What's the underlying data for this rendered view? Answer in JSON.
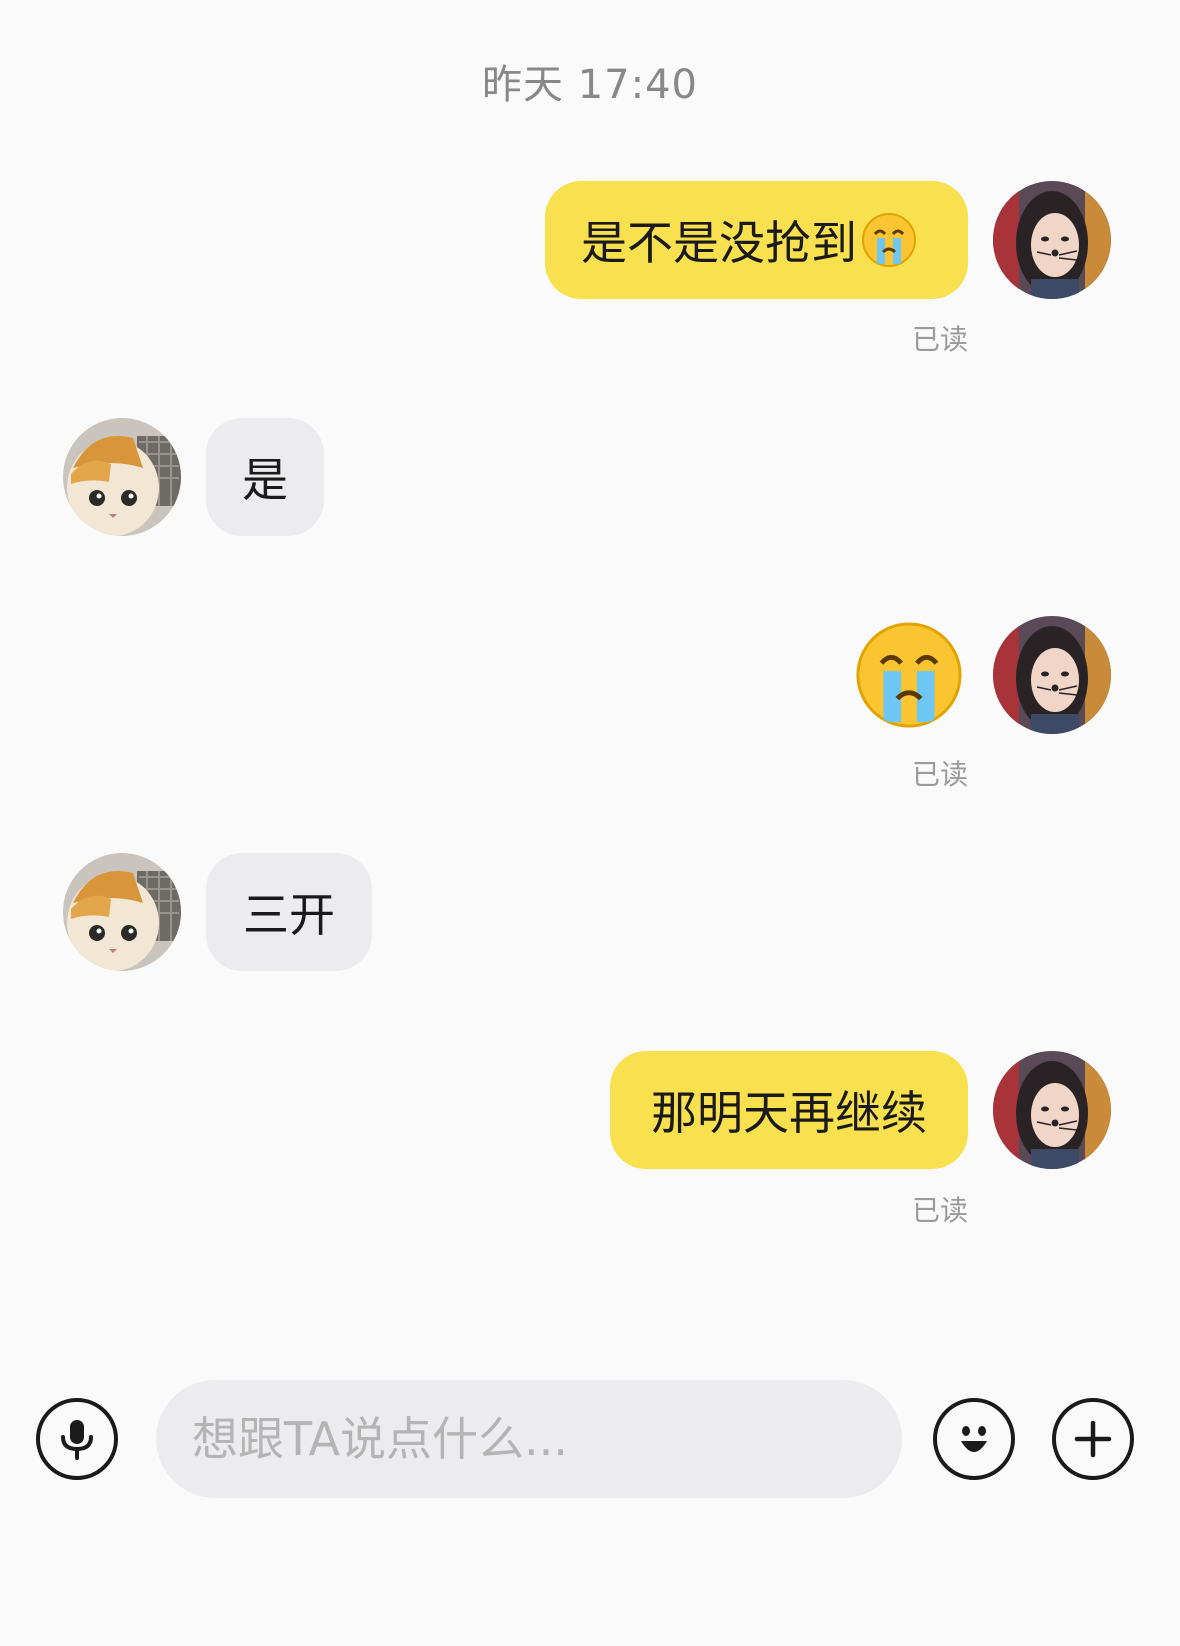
{
  "chat": {
    "timestamp": "昨天 17:40",
    "messages": [
      {
        "side": "mine",
        "text": "是不是没抢到",
        "inline_emoji": "crying-face-emoji",
        "status": "已读"
      },
      {
        "side": "theirs",
        "text": "是"
      },
      {
        "side": "mine",
        "sticker": "crying-face-emoji",
        "status": "已读"
      },
      {
        "side": "theirs",
        "text": "三开"
      },
      {
        "side": "mine",
        "text": "那明天再继续",
        "status": "已读"
      }
    ]
  },
  "input_bar": {
    "placeholder": "想跟TA说点什么...",
    "voice_icon": "microphone-icon",
    "emoji_icon": "smiley-icon",
    "more_icon": "plus-icon"
  },
  "colors": {
    "my_bubble": "#f9e04f",
    "their_bubble": "#ececee",
    "background": "#fafafa"
  }
}
